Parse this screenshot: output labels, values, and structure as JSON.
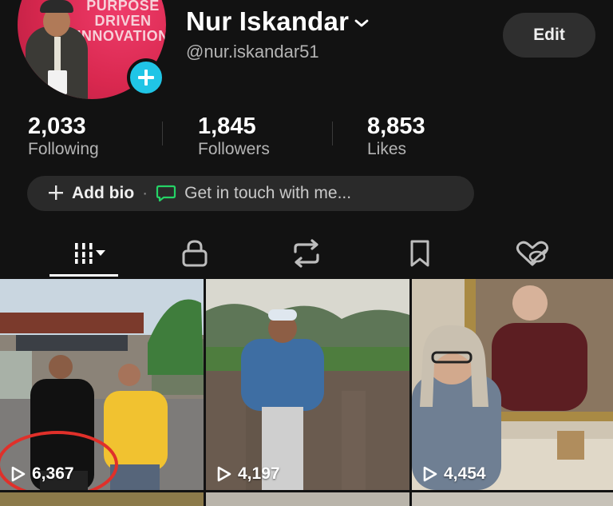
{
  "profile": {
    "name": "Nur Iskandar",
    "handle": "@nur.iskandar51",
    "edit_label": "Edit",
    "avatar_banner_lines": [
      "PURPOSE",
      "DRIVEN",
      "INNOVATION"
    ],
    "add_photo_icon": "plus-icon"
  },
  "stats": [
    {
      "value": "2,033",
      "label": "Following"
    },
    {
      "value": "1,845",
      "label": "Followers"
    },
    {
      "value": "8,853",
      "label": "Likes"
    }
  ],
  "bio": {
    "add_label": "Add bio",
    "separator": "·",
    "contact_label": "Get in touch with me..."
  },
  "tabs": [
    {
      "name": "videos",
      "icon": "grid-bars-icon",
      "active": true
    },
    {
      "name": "private",
      "icon": "lock-icon",
      "active": false
    },
    {
      "name": "reposts",
      "icon": "repost-icon",
      "active": false
    },
    {
      "name": "favorites",
      "icon": "bookmark-icon",
      "active": false
    },
    {
      "name": "liked",
      "icon": "heart-hidden-icon",
      "active": false
    }
  ],
  "videos": [
    {
      "views": "6,367",
      "scene": "two teenagers at city gate"
    },
    {
      "views": "4,197",
      "scene": "man in denim jacket in field"
    },
    {
      "views": "4,454",
      "scene": "woman in front of portrait painting"
    }
  ],
  "colors": {
    "background": "#121212",
    "accent_cyan": "#20c5e6",
    "pill_bg": "#2a2a2a",
    "message_icon": "#25d366",
    "annotation_circle": "#e0302a"
  }
}
